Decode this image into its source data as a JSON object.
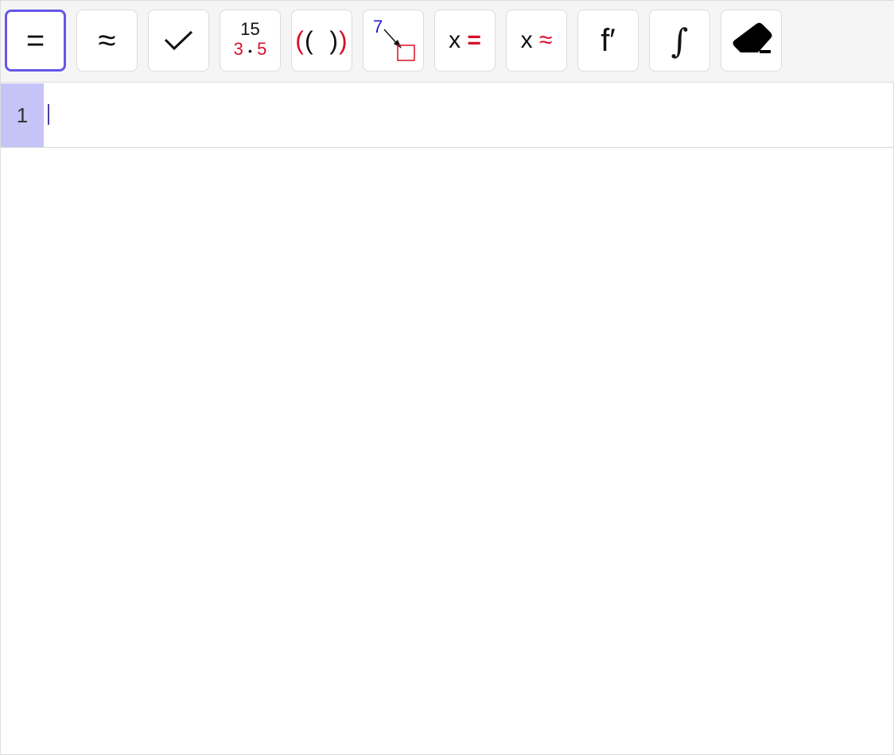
{
  "toolbar": {
    "buttons": [
      {
        "name": "evaluate",
        "label": "="
      },
      {
        "name": "numeric",
        "label": "≈"
      },
      {
        "name": "keep-input",
        "label": "✓"
      },
      {
        "name": "factor",
        "top": "15",
        "bottom_a": "3",
        "dot": "•",
        "bottom_b": "5"
      },
      {
        "name": "expand",
        "outer_l": "(",
        "inner_l": "(",
        "inner_r": ")",
        "outer_r": ")"
      },
      {
        "name": "substitute",
        "label": "7"
      },
      {
        "name": "solve",
        "x": "x",
        "sym": "="
      },
      {
        "name": "solve-numerically",
        "x": "x",
        "sym": "≈"
      },
      {
        "name": "derivative",
        "label": "f′"
      },
      {
        "name": "integral",
        "label": "∫"
      },
      {
        "name": "delete"
      }
    ]
  },
  "cas": {
    "rows": [
      {
        "number": "1",
        "input": ""
      }
    ]
  },
  "colors": {
    "accent": "#6557e8",
    "row_highlight": "#c6c3f6",
    "red": "#d8102a",
    "blue": "#2218d8"
  }
}
